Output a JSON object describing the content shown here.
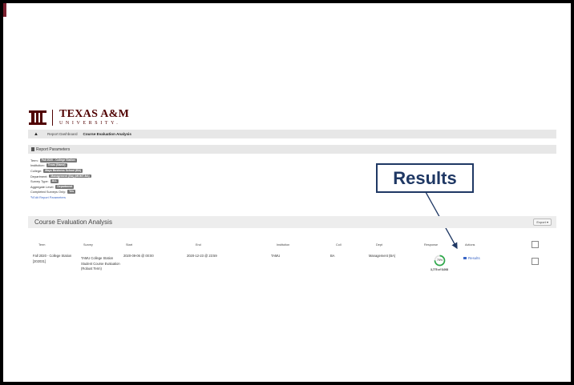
{
  "logo": {
    "line1": "TEXAS A&M",
    "line2": "UNIVERSITY."
  },
  "breadcrumb": {
    "item1": "Report Dashboard",
    "item2": "Course Evaluation Analysis"
  },
  "report_parameters": {
    "header": "Report Parameters",
    "rows": [
      {
        "label": "Term:",
        "value": "Fall 2020 - College Station"
      },
      {
        "label": "Institution:",
        "value": "Texas (Name)"
      },
      {
        "label": "College:",
        "value": "Mays Business School (BA)"
      },
      {
        "label": "Department:",
        "value": "Management (BA) (MGMT-BA)"
      },
      {
        "label": "Survey Type:",
        "value": "ALL"
      },
      {
        "label": "Aggregate Level:",
        "value": "Department"
      },
      {
        "label": "Completed Surveys Only:",
        "value": "Yes"
      }
    ],
    "edit_link": "Edit Report Parameters"
  },
  "callout": {
    "text": "Results"
  },
  "course_evaluation": {
    "title": "Course Evaluation Analysis",
    "export_label": "Export ▾",
    "columns": [
      "Term",
      "Survey",
      "Start",
      "End",
      "Institution",
      "Coll",
      "Dept",
      "Response",
      "Actions"
    ],
    "row": {
      "term": "Fall 2020 - College Station",
      "term_code": "[202031]",
      "survey_line1": "TAMU College Station",
      "survey_line2": "Student Course Evaluation",
      "survey_line3": "(Robust Term)",
      "start": "2020-09-06 @ 00:00",
      "end": "2020-12-23 @ 23:59",
      "institution": "TAMU",
      "coll": "BA",
      "dept": "Management (BA)",
      "response_pct": "75%",
      "response_fraction": 0.75,
      "response_count": "3,775 of 5,008",
      "action_label": "Results"
    }
  },
  "colors": {
    "maroon": "#500000",
    "callout_blue": "#1f3864",
    "link_blue": "#3b66c6",
    "donut_green": "#2ea84a"
  }
}
